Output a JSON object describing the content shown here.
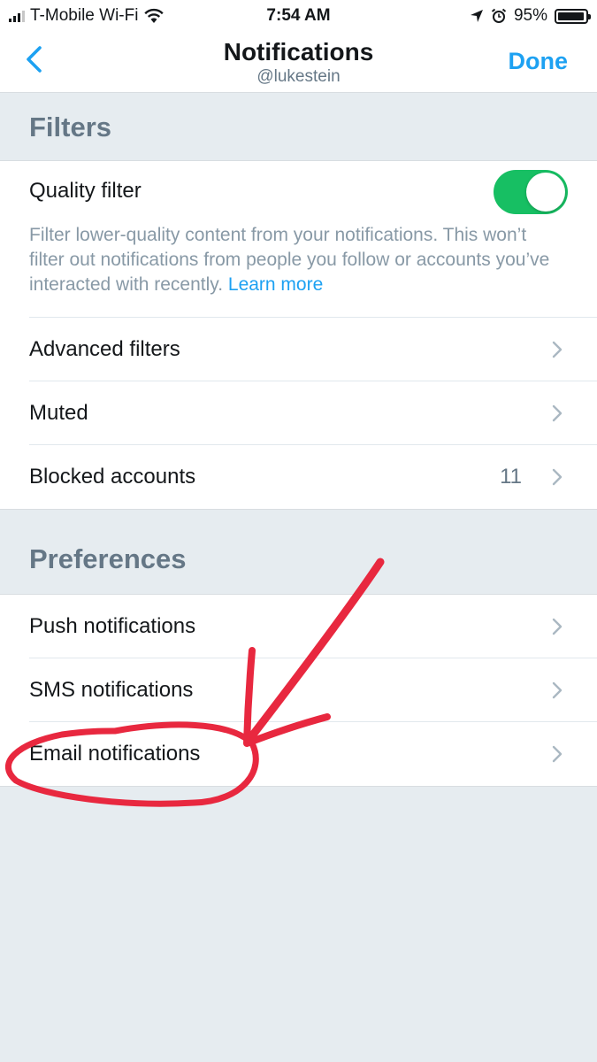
{
  "status_bar": {
    "carrier": "T-Mobile Wi-Fi",
    "time": "7:54 AM",
    "battery_text": "95%",
    "battery_level": 0.95,
    "icons": [
      "signal-icon",
      "wifi-icon",
      "location-arrow-icon",
      "alarm-icon",
      "battery-icon"
    ]
  },
  "nav": {
    "title": "Notifications",
    "subtitle": "@lukestein",
    "done_label": "Done",
    "back_icon": "chevron-left-icon"
  },
  "filters": {
    "header": "Filters",
    "quality_filter": {
      "label": "Quality filter",
      "enabled": true,
      "description": "Filter lower-quality content from your notifications. This won’t filter out notifications from people you follow or accounts you’ve interacted with recently.",
      "link_label": "Learn more"
    },
    "rows": [
      {
        "label": "Advanced filters",
        "value": ""
      },
      {
        "label": "Muted",
        "value": ""
      },
      {
        "label": "Blocked accounts",
        "value": "11"
      }
    ]
  },
  "preferences": {
    "header": "Preferences",
    "rows": [
      {
        "label": "Push notifications"
      },
      {
        "label": "SMS notifications"
      },
      {
        "label": "Email notifications"
      }
    ]
  },
  "colors": {
    "accent": "#1da1f2",
    "toggle_on": "#17bf63",
    "annotation": "#e8283f",
    "background": "#e6ecf0"
  }
}
